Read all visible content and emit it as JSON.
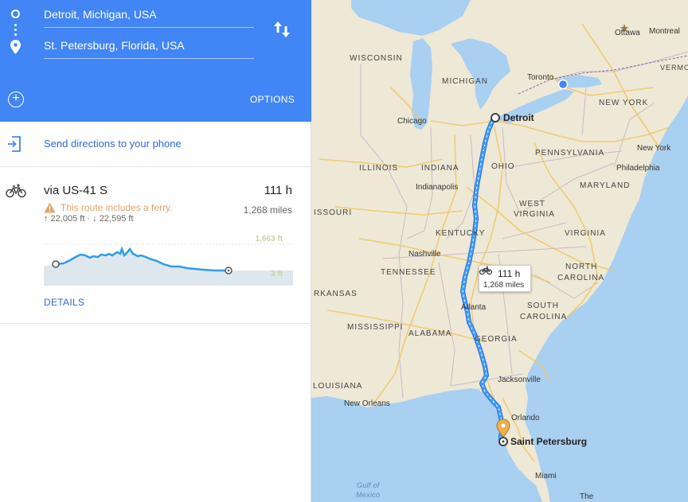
{
  "directions": {
    "origin": "Detroit, Michigan, USA",
    "destination": "St. Petersburg, Florida, USA",
    "options_label": "OPTIONS"
  },
  "send_to_phone": {
    "label": "Send directions to your phone"
  },
  "route": {
    "via": "via US-41 S",
    "time": "111 h",
    "distance": "1,268 miles",
    "warning": "This route includes a ferry.",
    "elevation_stats": "↑ 22,005 ft · ↓ 22,595 ft",
    "elevation_max": "1,663 ft",
    "elevation_min": "3 ft",
    "details_label": "DETAILS",
    "warning_color": "#e0a26a"
  },
  "map": {
    "route_color": "#4a9df5",
    "callout": {
      "time": "111 h",
      "distance": "1,268 miles"
    },
    "labels": {
      "wisconsin": "WISCONSIN",
      "michigan": "MICHIGAN",
      "ottawa": "Ottawa",
      "montreal": "Montreal",
      "toronto": "Toronto",
      "new_york_state": "NEW YORK",
      "chicago": "Chicago",
      "detroit": "Detroit",
      "vermont": "VERMONT",
      "illinois": "ILLINOIS",
      "indiana": "INDIANA",
      "ohio": "OHIO",
      "pennsylvania": "PENNSYLVANIA",
      "new_york_city": "New York",
      "indianapolis": "Indianapolis",
      "philadelphia": "Philadelphia",
      "maryland": "MARYLAND",
      "missouri": "ISSOURI",
      "west_virginia_1": "WEST",
      "west_virginia_2": "VIRGINIA",
      "kentucky": "KENTUCKY",
      "virginia": "VIRGINIA",
      "nashville": "Nashville",
      "tennessee": "TENNESSEE",
      "north_carolina_1": "NORTH",
      "north_carolina_2": "CAROLINA",
      "arkansas": "RKANSAS",
      "atlanta": "Atlanta",
      "south_carolina_1": "SOUTH",
      "south_carolina_2": "CAROLINA",
      "mississippi": "MISSISSIPPI",
      "alabama": "ALABAMA",
      "georgia": "GEORGIA",
      "jacksonville": "Jacksonville",
      "louisiana": "LOUISIANA",
      "new_orleans": "New Orleans",
      "orlando": "Orlando",
      "saint_petersburg": "Saint Petersburg",
      "gulf_1": "Gulf of",
      "gulf_2": "Mexico",
      "miami": "Miami",
      "the": "The"
    }
  }
}
